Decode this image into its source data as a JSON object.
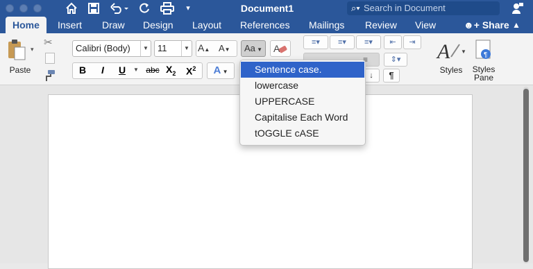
{
  "window": {
    "title": "Document1"
  },
  "quick_access": {
    "home_icon": "home-icon",
    "save_icon": "save-icon",
    "undo_icon": "undo-icon",
    "redo_icon": "redo-icon",
    "print_icon": "print-icon"
  },
  "search": {
    "placeholder": "Search in Document"
  },
  "tabs": [
    {
      "label": "Home"
    },
    {
      "label": "Insert"
    },
    {
      "label": "Draw"
    },
    {
      "label": "Design"
    },
    {
      "label": "Layout"
    },
    {
      "label": "References"
    },
    {
      "label": "Mailings"
    },
    {
      "label": "Review"
    },
    {
      "label": "View"
    }
  ],
  "share": {
    "label": "Share"
  },
  "clipboard": {
    "paste_label": "Paste"
  },
  "font": {
    "family": "Calibri (Body)",
    "size": "11",
    "grow_label": "A",
    "shrink_label": "A",
    "case_label": "Aa",
    "bold": "B",
    "italic": "I",
    "underline": "U",
    "strike": "abc",
    "sub": "X",
    "sub_small": "2",
    "sup": "X",
    "sup_small": "2",
    "effects": "A"
  },
  "styles": {
    "label": "Styles",
    "pane_label1": "Styles",
    "pane_label2": "Pane"
  },
  "case_menu": {
    "items": [
      "Sentence case.",
      "lowercase",
      "UPPERCASE",
      "Capitalise Each Word",
      "tOGGLE cASE"
    ],
    "selected_index": 0
  },
  "colors": {
    "brand": "#2b579a",
    "menu_selected": "#2f63c9"
  }
}
